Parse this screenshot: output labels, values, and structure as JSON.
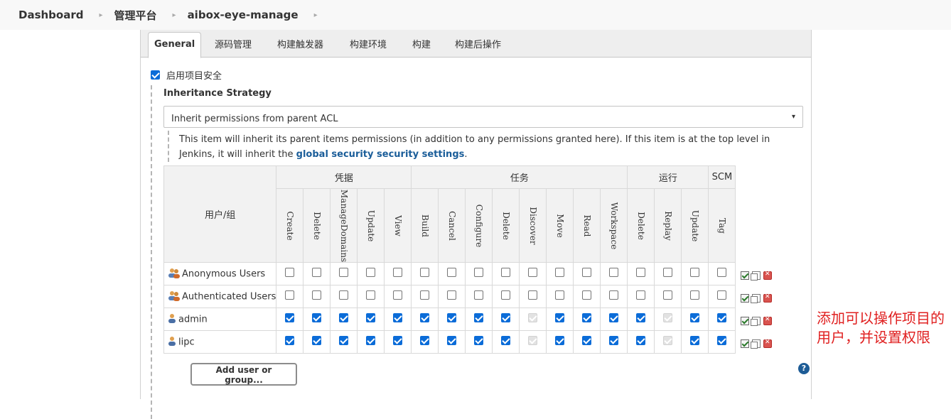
{
  "breadcrumb": {
    "items": [
      "Dashboard",
      "管理平台",
      "aibox-eye-manage"
    ],
    "sep": "▸"
  },
  "tabs": [
    "General",
    "源码管理",
    "构建触发器",
    "构建环境",
    "构建",
    "构建后操作"
  ],
  "enable_security": {
    "label": "启用项目安全",
    "checked": true
  },
  "inheritance": {
    "title": "Inheritance Strategy",
    "selected": "Inherit permissions from parent ACL",
    "arrow": "▾",
    "desc_before": "This item will inherit its parent items permissions (in addition to any permissions granted here). If this item is at the top level in Jenkins, it will inherit the ",
    "desc_link": "global security security settings",
    "desc_after": "."
  },
  "matrix": {
    "user_header": "用户/组",
    "groups": [
      {
        "name": "凭据",
        "span": 5
      },
      {
        "name": "任务",
        "span": 8
      },
      {
        "name": "运行",
        "span": 3
      },
      {
        "name": "SCM",
        "span": 1
      }
    ],
    "permissions": [
      "Create",
      "Delete",
      "ManageDomains",
      "Update",
      "View",
      "Build",
      "Cancel",
      "Configure",
      "Delete",
      "Discover",
      "Move",
      "Read",
      "Workspace",
      "Delete",
      "Replay",
      "Update",
      "Tag"
    ],
    "rows": [
      {
        "name": "Anonymous Users",
        "icon": "group-icon",
        "checks": [
          0,
          0,
          0,
          0,
          0,
          0,
          0,
          0,
          0,
          0,
          0,
          0,
          0,
          0,
          0,
          0,
          0
        ]
      },
      {
        "name": "Authenticated Users",
        "icon": "group-icon",
        "checks": [
          0,
          0,
          0,
          0,
          0,
          0,
          0,
          0,
          0,
          0,
          0,
          0,
          0,
          0,
          0,
          0,
          0
        ]
      },
      {
        "name": "admin",
        "icon": "user-icon",
        "checks": [
          1,
          1,
          1,
          1,
          1,
          1,
          1,
          1,
          1,
          2,
          1,
          1,
          1,
          1,
          2,
          1,
          1
        ]
      },
      {
        "name": "lipc",
        "icon": "user-icon",
        "checks": [
          1,
          1,
          1,
          1,
          1,
          1,
          1,
          1,
          1,
          2,
          1,
          1,
          1,
          1,
          2,
          1,
          1
        ]
      }
    ]
  },
  "add_button": "Add user or group...",
  "help": "?",
  "annotation": "添加可以操作项目的用户，并设置权限",
  "colors": {
    "accent": "#0b6cd8",
    "link": "#1a5d99",
    "annotation": "#e02020"
  }
}
